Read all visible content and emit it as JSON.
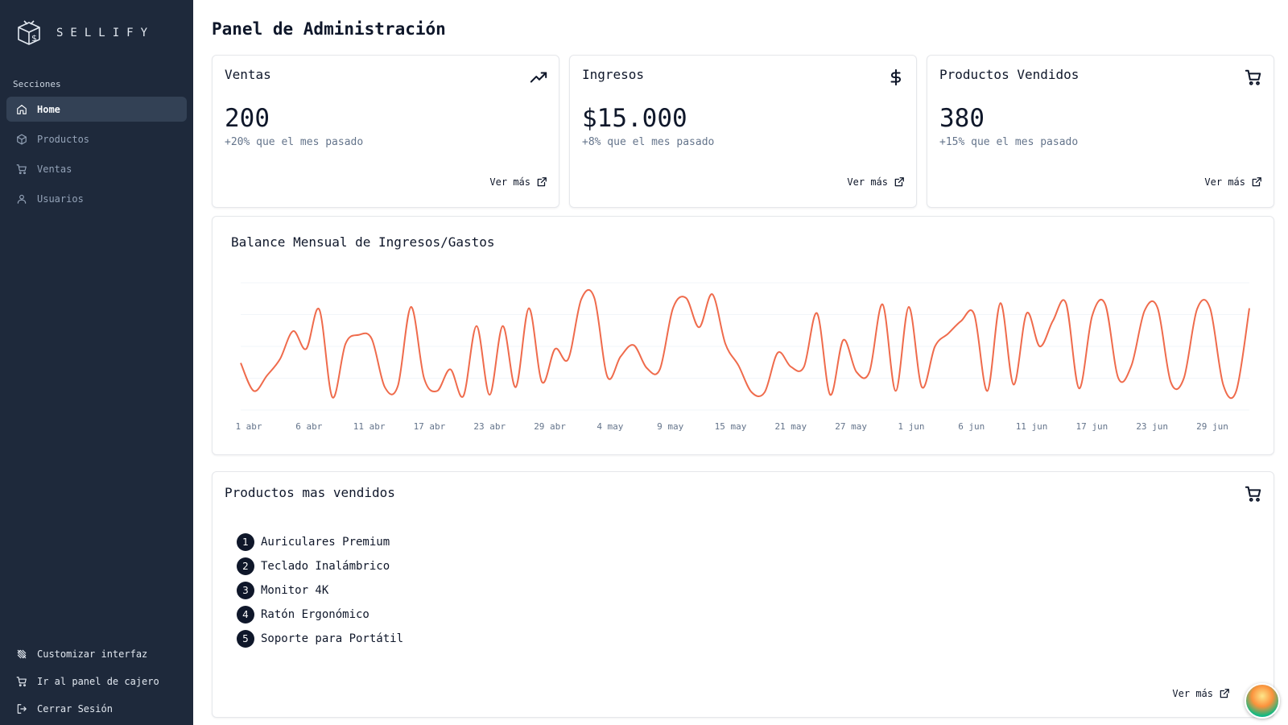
{
  "brand": {
    "name": "SELLIFY",
    "logo_icon": "box-s-logo-icon"
  },
  "sidebar": {
    "section_label": "Secciones",
    "items": [
      {
        "label": "Home",
        "icon": "home-icon",
        "active": true
      },
      {
        "label": "Productos",
        "icon": "package-icon",
        "active": false
      },
      {
        "label": "Ventas",
        "icon": "cart-icon",
        "active": false
      },
      {
        "label": "Usuarios",
        "icon": "user-icon",
        "active": false
      }
    ],
    "bottom_items": [
      {
        "label": "Customizar interfaz",
        "icon": "tools-icon"
      },
      {
        "label": "Ir al panel de cajero",
        "icon": "cart-icon"
      },
      {
        "label": "Cerrar Sesión",
        "icon": "logout-icon"
      }
    ]
  },
  "page": {
    "title": "Panel de Administración"
  },
  "stats": [
    {
      "title": "Ventas",
      "value": "200",
      "sub": "+20% que el mes pasado",
      "link": "Ver más",
      "icon": "trending-up-icon"
    },
    {
      "title": "Ingresos",
      "value": "$15.000",
      "sub": "+8% que el mes pasado",
      "link": "Ver más",
      "icon": "dollar-icon"
    },
    {
      "title": "Productos Vendidos",
      "value": "380",
      "sub": "+15% que el mes pasado",
      "link": "Ver más",
      "icon": "cart-icon"
    }
  ],
  "chart": {
    "title": "Balance Mensual de Ingresos/Gastos",
    "line_color": "#ef6b4c",
    "x_ticks": [
      "1 abr",
      "6 abr",
      "11 abr",
      "17 abr",
      "23 abr",
      "29 abr",
      "4 may",
      "9 may",
      "15 may",
      "21 may",
      "27 may",
      "1 jun",
      "6 jun",
      "11 jun",
      "17 jun",
      "23 jun",
      "29 jun"
    ]
  },
  "chart_data": {
    "type": "line",
    "title": "Balance Mensual de Ingresos/Gastos",
    "xlabel": "",
    "ylabel": "",
    "x_ticks": [
      "1 abr",
      "6 abr",
      "11 abr",
      "17 abr",
      "23 abr",
      "29 abr",
      "4 may",
      "9 may",
      "15 may",
      "21 may",
      "27 may",
      "1 jun",
      "6 jun",
      "11 jun",
      "17 jun",
      "23 jun",
      "29 jun"
    ],
    "grid": true,
    "ylim": [
      0,
      100
    ],
    "series": [
      {
        "values": [
          37,
          15,
          27,
          40,
          62,
          48,
          79,
          10,
          52,
          59,
          56,
          18,
          19,
          81,
          25,
          15,
          32,
          11,
          66,
          12,
          66,
          18,
          80,
          22,
          48,
          40,
          87,
          88,
          26,
          42,
          51,
          33,
          32,
          80,
          88,
          65,
          91,
          52,
          35,
          14,
          14,
          45,
          34,
          34,
          76,
          12,
          55,
          30,
          30,
          83,
          15,
          81,
          18,
          50,
          60,
          70,
          75,
          15,
          84,
          20,
          76,
          50,
          70,
          84,
          17,
          74,
          83,
          25,
          35,
          78,
          80,
          22,
          25,
          79,
          80,
          20,
          15,
          80
        ]
      }
    ]
  },
  "top_products": {
    "title": "Productos mas vendidos",
    "icon": "cart-icon",
    "items": [
      {
        "rank": "1",
        "name": "Auriculares Premium"
      },
      {
        "rank": "2",
        "name": "Teclado Inalámbrico"
      },
      {
        "rank": "3",
        "name": "Monitor 4K"
      },
      {
        "rank": "4",
        "name": "Ratón Ergonómico"
      },
      {
        "rank": "5",
        "name": "Soporte para Portátil"
      }
    ],
    "link": "Ver más"
  }
}
